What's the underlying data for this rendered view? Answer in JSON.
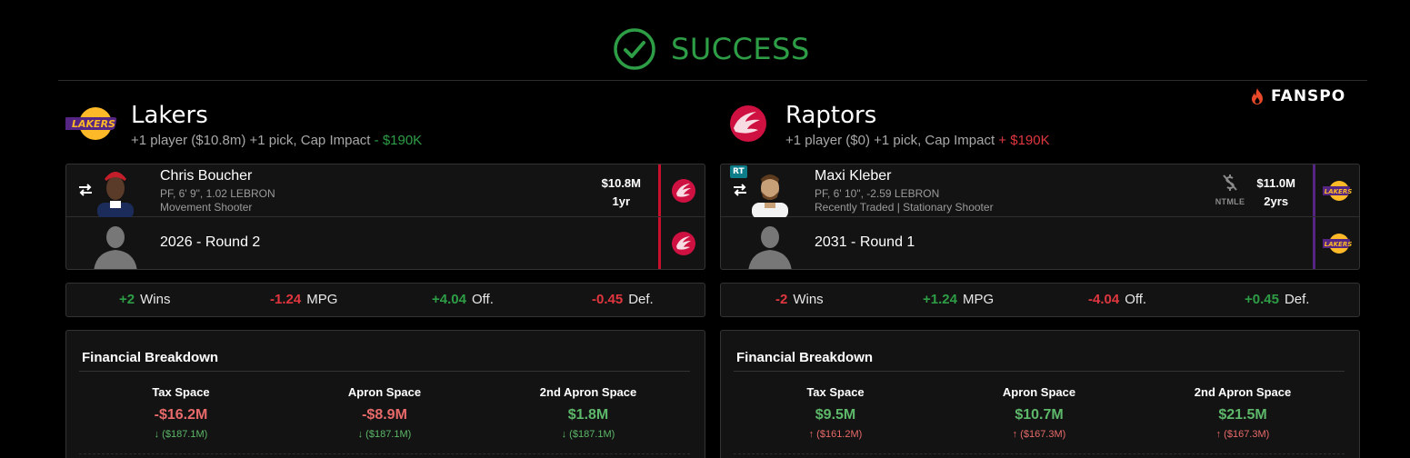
{
  "header": {
    "status": "SUCCESS",
    "brand": "FANSPO"
  },
  "colors": {
    "success": "#2e9e46",
    "positive": "#2e9e46",
    "negative": "#e0363f",
    "raptors_bar": "#c8102e",
    "lakers_bar": "#552583"
  },
  "teams": [
    {
      "name": "Lakers",
      "logo": "lakers-logo",
      "summary_prefix": "+1 player ($10.8m) +1 pick, Cap Impact",
      "cap_sign": "-",
      "cap_value": "$190K",
      "assets": [
        {
          "type": "player",
          "name": "Chris Boucher",
          "meta1": "PF, 6' 9\", 1.02 LEBRON",
          "meta2": "Movement Shooter",
          "salary": "$10.8M",
          "years": "1yr",
          "from_logo": "raptors-logo"
        },
        {
          "type": "pick",
          "label": "2026 - Round 2",
          "from_logo": "raptors-logo"
        }
      ],
      "stats": [
        {
          "value": "+2",
          "label": "Wins",
          "sign": "pos"
        },
        {
          "value": "-1.24",
          "label": "MPG",
          "sign": "neg"
        },
        {
          "value": "+4.04",
          "label": "Off.",
          "sign": "pos"
        },
        {
          "value": "-0.45",
          "label": "Def.",
          "sign": "neg"
        }
      ],
      "financial": {
        "title": "Financial Breakdown",
        "cols": [
          {
            "head": "Tax Space",
            "value": "-$16.2M",
            "sign": "neg",
            "sub": "($187.1M)",
            "dir": "down"
          },
          {
            "head": "Apron Space",
            "value": "-$8.9M",
            "sign": "neg",
            "sub": "($187.1M)",
            "dir": "down"
          },
          {
            "head": "2nd Apron Space",
            "value": "$1.8M",
            "sign": "pos",
            "sub": "($187.1M)",
            "dir": "down"
          }
        ]
      }
    },
    {
      "name": "Raptors",
      "logo": "raptors-logo",
      "summary_prefix": "+1 player ($0) +1 pick, Cap Impact",
      "cap_sign": "+",
      "cap_value": "$190K",
      "assets": [
        {
          "type": "player",
          "badge": "RT",
          "name": "Maxi Kleber",
          "meta1": "PF, 6' 10\", -2.59 LEBRON",
          "meta2": "Recently Traded | Stationary Shooter",
          "salary": "$11.0M",
          "years": "2yrs",
          "ntmle": "NTMLE",
          "from_logo": "lakers-logo"
        },
        {
          "type": "pick",
          "label": "2031 - Round 1",
          "from_logo": "lakers-logo"
        }
      ],
      "stats": [
        {
          "value": "-2",
          "label": "Wins",
          "sign": "neg"
        },
        {
          "value": "+1.24",
          "label": "MPG",
          "sign": "pos"
        },
        {
          "value": "-4.04",
          "label": "Off.",
          "sign": "neg"
        },
        {
          "value": "+0.45",
          "label": "Def.",
          "sign": "pos"
        }
      ],
      "financial": {
        "title": "Financial Breakdown",
        "cols": [
          {
            "head": "Tax Space",
            "value": "$9.5M",
            "sign": "pos",
            "sub": "($161.2M)",
            "dir": "up"
          },
          {
            "head": "Apron Space",
            "value": "$10.7M",
            "sign": "pos",
            "sub": "($167.3M)",
            "dir": "up"
          },
          {
            "head": "2nd Apron Space",
            "value": "$21.5M",
            "sign": "pos",
            "sub": "($167.3M)",
            "dir": "up"
          }
        ]
      }
    }
  ]
}
